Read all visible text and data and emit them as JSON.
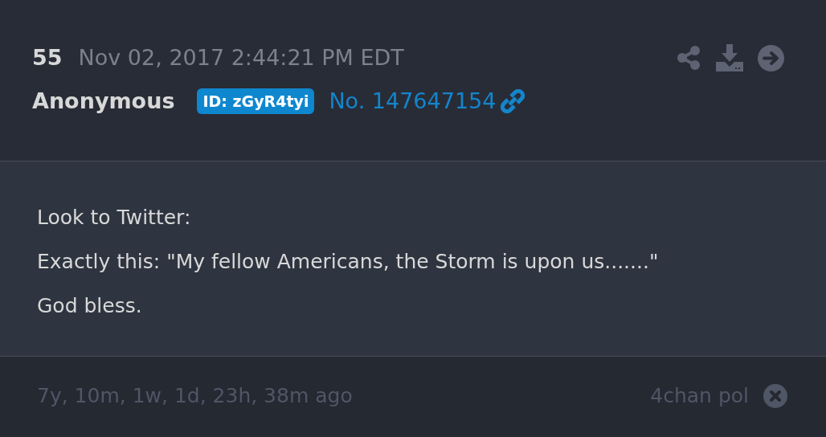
{
  "post": {
    "number": "55",
    "date": "Nov 02, 2017 2:44:21 PM EDT",
    "author": "Anonymous",
    "poster_id": "ID: zGyR4tyi",
    "post_no": "No. 147647154",
    "lines": [
      "Look to Twitter:",
      "Exactly this: \"My fellow Americans, the Storm is upon us.......\"",
      "God bless."
    ],
    "age": "7y, 10m, 1w, 1d, 23h, 38m ago",
    "source": "4chan pol"
  }
}
